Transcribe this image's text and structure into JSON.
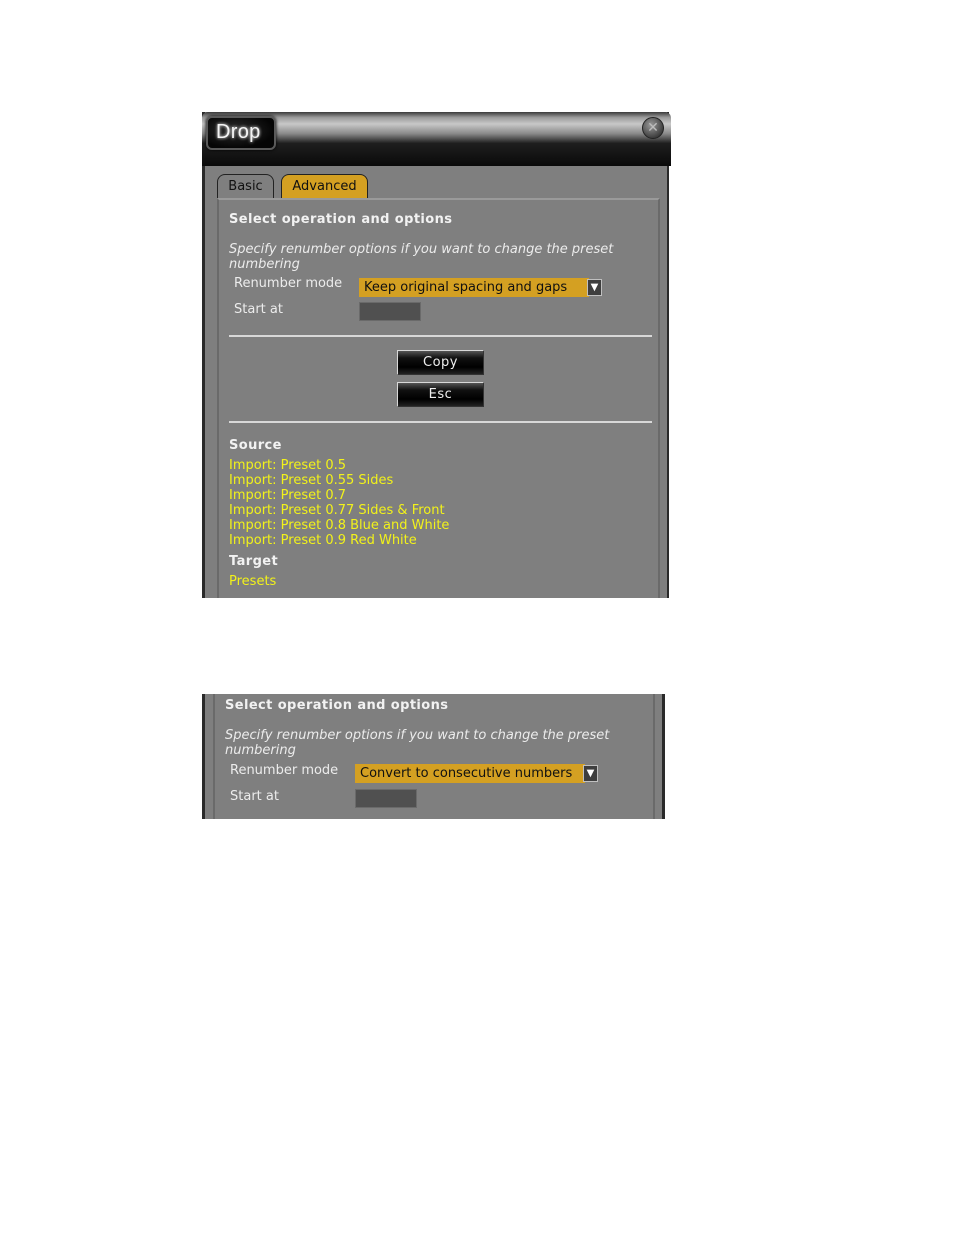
{
  "dialog": {
    "title": "Drop",
    "close_icon": "close-circle-icon",
    "tabs": [
      {
        "label": "Basic",
        "active": false
      },
      {
        "label": "Advanced",
        "active": true
      }
    ],
    "options": {
      "section_title": "Select operation and options",
      "hint": "Specify renumber options if you want to change the preset numbering",
      "renumber_mode_label": "Renumber mode",
      "renumber_mode_value": "Keep original spacing and gaps",
      "start_at_label": "Start at",
      "start_at_value": ""
    },
    "buttons": {
      "copy": "Copy",
      "esc": "Esc"
    },
    "source": {
      "title": "Source",
      "items": [
        "Import: Preset 0.5",
        "Import: Preset 0.55 Sides",
        "Import: Preset 0.7",
        "Import: Preset 0.77 Sides & Front",
        "Import: Preset 0.8 Blue and White",
        "Import: Preset 0.9 Red White"
      ]
    },
    "target": {
      "title": "Target",
      "items": [
        "Presets"
      ]
    }
  },
  "snippet": {
    "section_title": "Select operation and options",
    "hint": "Specify renumber options if you want to change the preset numbering",
    "renumber_mode_label": "Renumber mode",
    "renumber_mode_value": "Convert to consecutive numbers",
    "start_at_label": "Start at",
    "start_at_value": ""
  },
  "colors": {
    "panel_bg": "#7f7f7f",
    "accent": "#d4a022",
    "link_yellow": "#f2f21a",
    "title_dark": "#0a0a0a"
  }
}
